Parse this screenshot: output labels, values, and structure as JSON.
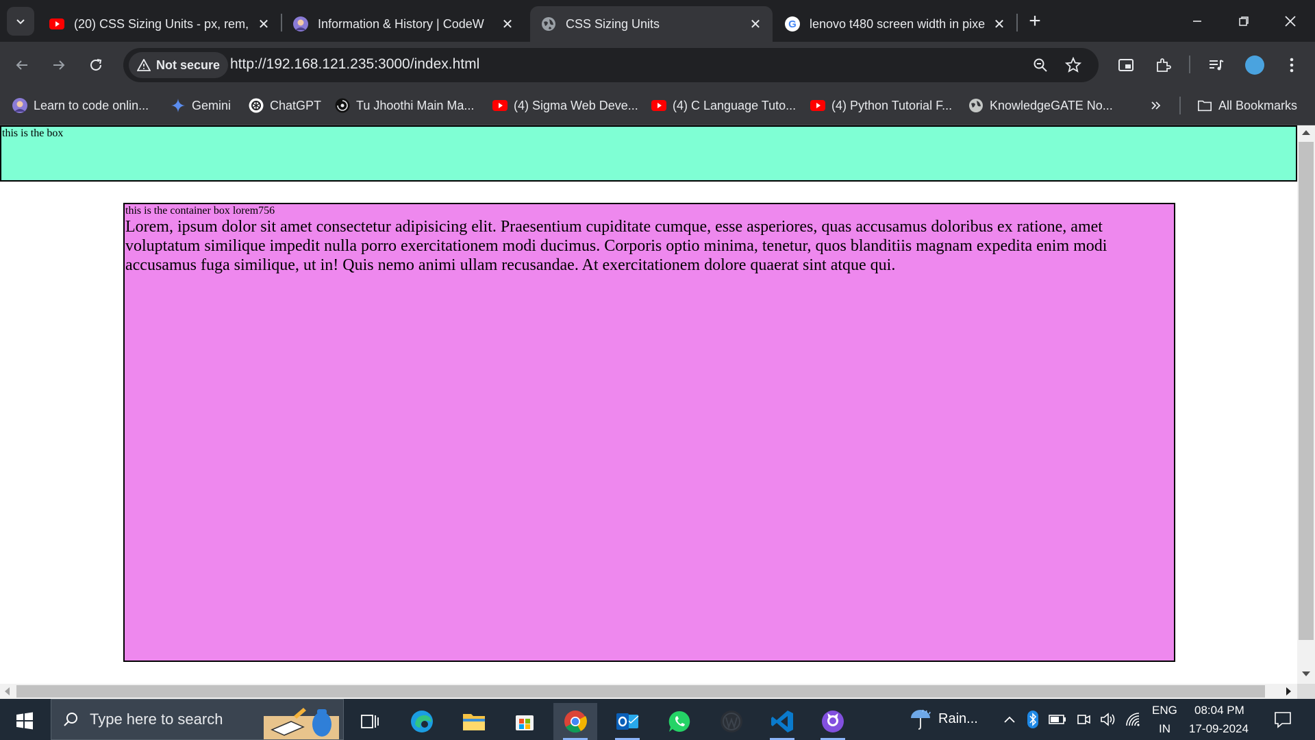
{
  "browser": {
    "tabs": [
      {
        "title": "(20) CSS Sizing Units - px, rem,",
        "favicon": "youtube-icon",
        "active": false
      },
      {
        "title": "Information & History | CodeW",
        "favicon": "codewithharry-avatar-icon",
        "active": false
      },
      {
        "title": "CSS Sizing Units",
        "favicon": "globe-icon",
        "active": true
      },
      {
        "title": "lenovo t480 screen width in pixe",
        "favicon": "google-icon",
        "active": false
      }
    ],
    "address_bar": {
      "security_label": "Not secure",
      "url": "http://192.168.121.235:3000/index.html"
    },
    "bookmarks": [
      {
        "label": "Learn to code onlin...",
        "icon": "codewithharry-avatar-icon"
      },
      {
        "label": "Gemini",
        "icon": "gemini-icon"
      },
      {
        "label": "ChatGPT",
        "icon": "chatgpt-icon"
      },
      {
        "label": "Tu Jhoothi Main Ma...",
        "icon": "movie-site-icon"
      },
      {
        "label": "(4) Sigma Web Deve...",
        "icon": "youtube-icon"
      },
      {
        "label": "(4) C Language Tuto...",
        "icon": "youtube-icon"
      },
      {
        "label": "(4) Python Tutorial F...",
        "icon": "youtube-icon"
      },
      {
        "label": "KnowledgeGATE No...",
        "icon": "globe-icon"
      }
    ],
    "all_bookmarks_label": "All Bookmarks"
  },
  "page": {
    "box_text": "this is the box",
    "container_heading": "this is the container box lorem756",
    "container_paragraph": "Lorem, ipsum dolor sit amet consectetur adipisicing elit. Praesentium cupiditate cumque, esse asperiores, quas accusamus doloribus ex ratione, amet voluptatum similique impedit nulla porro exercitationem modi ducimus. Corporis optio minima, tenetur, quos blanditiis magnam expedita enim modi accusamus fuga similique, ut in! Quis nemo animi ullam recusandae. At exercitationem dolore quaerat sint atque qui.",
    "colors": {
      "box": "#7fffd4",
      "container": "#ee88ee"
    }
  },
  "taskbar": {
    "search_placeholder": "Type here to search",
    "weather": "Rain...",
    "language_top": "ENG",
    "language_bottom": "IN",
    "time": "08:04 PM",
    "date": "17-09-2024"
  }
}
